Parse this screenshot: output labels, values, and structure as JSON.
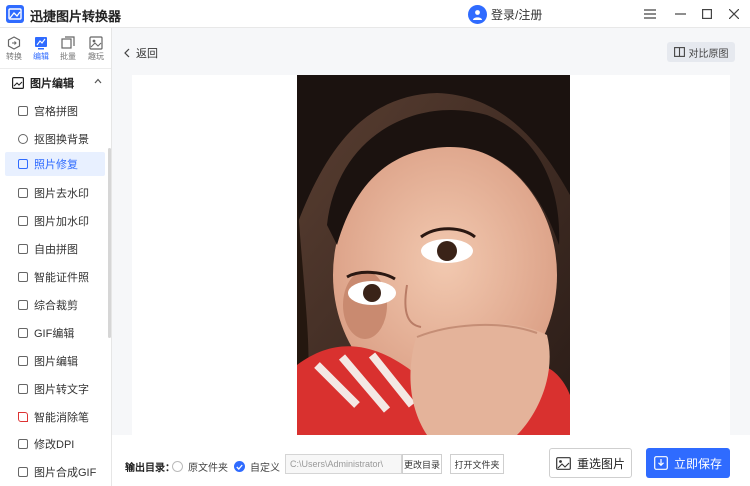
{
  "app": {
    "title": "迅捷图片转换器",
    "login_label": "登录/注册"
  },
  "colors": {
    "accent": "#2f6bff",
    "active_bg": "#e8f0ff"
  },
  "modes": [
    {
      "label": "转换",
      "icon": "convert-icon"
    },
    {
      "label": "编辑",
      "icon": "edit-icon",
      "active": true
    },
    {
      "label": "批量",
      "icon": "batch-icon"
    },
    {
      "label": "趣玩",
      "icon": "fun-icon"
    }
  ],
  "sidebar": {
    "group_label": "图片编辑",
    "items": [
      {
        "label": "宫格拼图",
        "icon": "grid-icon"
      },
      {
        "label": "抠图换背景",
        "icon": "cutout-icon"
      },
      {
        "label": "照片修复",
        "icon": "photo-repair-icon",
        "active": true
      },
      {
        "label": "图片去水印",
        "icon": "remove-watermark-icon"
      },
      {
        "label": "图片加水印",
        "icon": "add-watermark-icon"
      },
      {
        "label": "自由拼图",
        "icon": "free-collage-icon"
      },
      {
        "label": "智能证件照",
        "icon": "id-photo-icon"
      },
      {
        "label": "综合裁剪",
        "icon": "crop-icon"
      },
      {
        "label": "GIF编辑",
        "icon": "gif-icon"
      },
      {
        "label": "图片编辑",
        "icon": "image-edit-icon"
      },
      {
        "label": "图片转文字",
        "icon": "ocr-icon"
      },
      {
        "label": "智能消除笔",
        "icon": "eraser-icon"
      },
      {
        "label": "修改DPI",
        "icon": "dpi-icon"
      },
      {
        "label": "图片合成GIF",
        "icon": "make-gif-icon"
      }
    ]
  },
  "main": {
    "back_label": "返回",
    "compare_label": "对比原图",
    "output": {
      "label": "输出目录：",
      "option_original": "原文件夹",
      "option_custom": "自定义",
      "selected": "custom",
      "path": "C:\\Users\\Administrator\\",
      "change_dir_label": "更改目录",
      "open_folder_label": "打开文件夹"
    },
    "reselect_label": "重选图片",
    "save_label": "立即保存"
  }
}
